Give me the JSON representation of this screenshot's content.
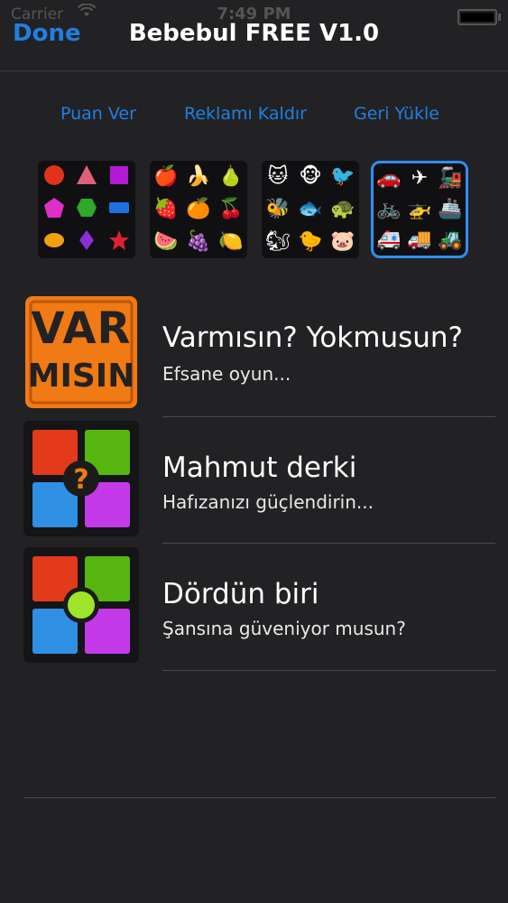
{
  "status_bar": {
    "carrier": "Carrier",
    "time": "7:49 PM"
  },
  "nav": {
    "done_label": "Done",
    "title": "Bebebul FREE V1.0"
  },
  "actions": {
    "rate": "Puan Ver",
    "remove_ads": "Reklamı Kaldır",
    "restore": "Geri Yükle"
  },
  "themes": [
    {
      "name": "shapes",
      "selected": false
    },
    {
      "name": "fruits",
      "selected": false
    },
    {
      "name": "animals",
      "selected": false
    },
    {
      "name": "vehicles",
      "selected": true
    }
  ],
  "games": [
    {
      "icon": "var-misin-icon",
      "icon_lines": [
        "VAR",
        "MISIN"
      ],
      "title": "Varmısın? Yokmusun?",
      "subtitle": "Efsane oyun..."
    },
    {
      "icon": "mahmut-derki-icon",
      "title": "Mahmut derki",
      "subtitle": "Hafızanızı güçlendirin..."
    },
    {
      "icon": "dordun-biri-icon",
      "title": "Dördün biri",
      "subtitle": "Şansına güveniyor musun?"
    }
  ],
  "colors": {
    "accent": "#1f7fe0",
    "background": "#222225",
    "selected_border": "#2f8ef0"
  }
}
